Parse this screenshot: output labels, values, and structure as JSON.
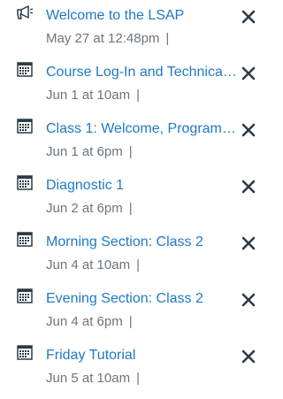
{
  "colors": {
    "link": "#1f79c8",
    "meta": "#6b757c",
    "icon": "#2d3b45"
  },
  "todo": {
    "items": [
      {
        "icon": "announcement-icon",
        "title": "Welcome to the LSAP",
        "date": "May 27 at 12:48pm",
        "separator": "|"
      },
      {
        "icon": "calendar-icon",
        "title": "Course Log-In and Technica…",
        "date": "Jun 1 at 10am",
        "separator": "|"
      },
      {
        "icon": "calendar-icon",
        "title": "Class 1: Welcome, Program…",
        "date": "Jun 1 at 6pm",
        "separator": "|"
      },
      {
        "icon": "calendar-icon",
        "title": "Diagnostic 1",
        "date": "Jun 2 at 6pm",
        "separator": "|"
      },
      {
        "icon": "calendar-icon",
        "title": "Morning Section: Class 2",
        "date": "Jun 4 at 10am",
        "separator": "|"
      },
      {
        "icon": "calendar-icon",
        "title": "Evening Section: Class 2",
        "date": "Jun 4 at 6pm",
        "separator": "|"
      },
      {
        "icon": "calendar-icon",
        "title": "Friday Tutorial",
        "date": "Jun 5 at 10am",
        "separator": "|"
      }
    ]
  }
}
